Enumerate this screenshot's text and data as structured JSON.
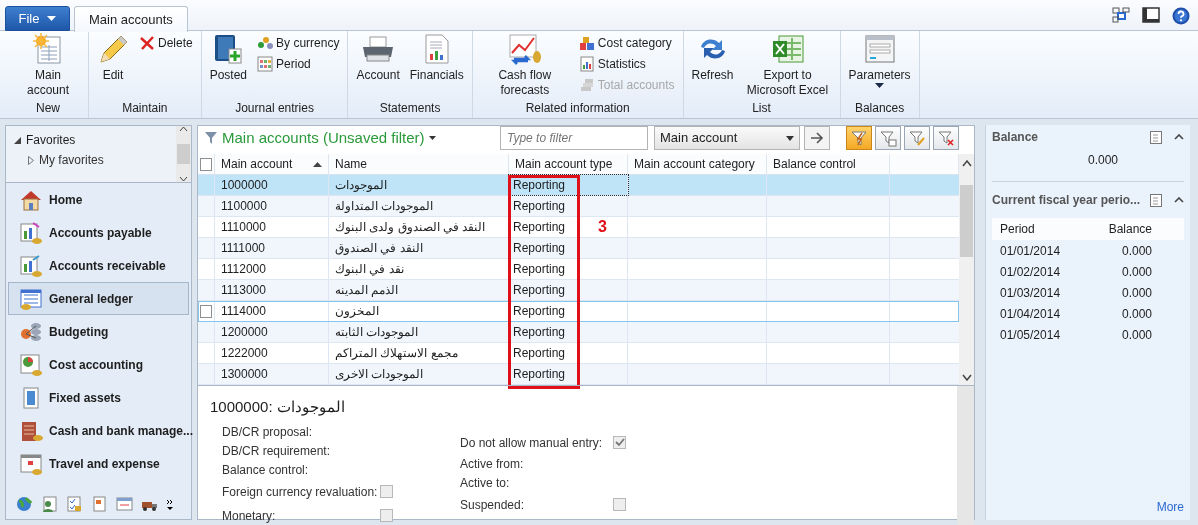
{
  "file_menu": {
    "label": "File"
  },
  "tabs": [
    {
      "label": "Main accounts",
      "selected": true
    }
  ],
  "ribbon": [
    {
      "label": "New",
      "buttons": [
        {
          "kind": "large",
          "label": "Main account",
          "disabled": false
        }
      ]
    },
    {
      "label": "Maintain",
      "buttons": [
        {
          "kind": "large",
          "label": "Edit",
          "disabled": false
        },
        {
          "kind": "small",
          "label": "Delete",
          "disabled": false
        }
      ]
    },
    {
      "label": "Journal entries",
      "buttons": [
        {
          "kind": "large",
          "label": "Posted",
          "disabled": false
        },
        {
          "kind": "small",
          "label": "By currency",
          "disabled": false
        },
        {
          "kind": "small",
          "label": "Period",
          "disabled": false
        }
      ]
    },
    {
      "label": "Statements",
      "buttons": [
        {
          "kind": "large",
          "label": "Account",
          "disabled": false
        },
        {
          "kind": "large",
          "label": "Financials",
          "disabled": false
        }
      ]
    },
    {
      "label": "Related information",
      "buttons": [
        {
          "kind": "large",
          "label": "Cash flow forecasts",
          "disabled": false
        },
        {
          "kind": "small",
          "label": "Cost category",
          "disabled": false
        },
        {
          "kind": "small",
          "label": "Statistics",
          "disabled": false
        },
        {
          "kind": "small",
          "label": "Total accounts",
          "disabled": true
        }
      ]
    },
    {
      "label": "List",
      "buttons": [
        {
          "kind": "large",
          "label": "Refresh",
          "disabled": false
        },
        {
          "kind": "large",
          "label": "Export to Microsoft Excel",
          "disabled": false
        }
      ]
    },
    {
      "label": "Balances",
      "buttons": [
        {
          "kind": "dropdown",
          "label": "Parameters",
          "disabled": false
        }
      ]
    }
  ],
  "nav": {
    "favorites": {
      "label": "Favorites",
      "expanded": true,
      "children": [
        {
          "label": "My favorites",
          "expanded": false
        }
      ]
    },
    "modules": [
      {
        "label": "Home",
        "selected": false
      },
      {
        "label": "Accounts payable",
        "selected": false
      },
      {
        "label": "Accounts receivable",
        "selected": false
      },
      {
        "label": "General ledger",
        "selected": true
      },
      {
        "label": "Budgeting",
        "selected": false
      },
      {
        "label": "Cost accounting",
        "selected": false
      },
      {
        "label": "Fixed assets",
        "selected": false
      },
      {
        "label": "Cash and bank manage...",
        "selected": false
      },
      {
        "label": "Travel and expense",
        "selected": false
      }
    ]
  },
  "grid": {
    "title": "Main accounts (Unsaved filter)",
    "filter_placeholder": "Type to filter",
    "filter_field": "Main account",
    "select_all": {
      "checked": false
    },
    "filter_buttons": [
      {
        "selected": true
      },
      {
        "selected": false
      },
      {
        "selected": false
      },
      {
        "selected": false
      }
    ],
    "columns": [
      {
        "label": "Main account",
        "sorted": true
      },
      {
        "label": "Name",
        "sorted": false
      },
      {
        "label": "Main account type",
        "sorted": false
      },
      {
        "label": "Main account category",
        "sorted": false
      },
      {
        "label": "Balance control",
        "sorted": false
      }
    ],
    "rows": [
      {
        "account": "1000000",
        "name": "الموجودات",
        "type": "Reporting",
        "selected": true,
        "hovered": false
      },
      {
        "account": "1100000",
        "name": "الموجودات المتداولة",
        "type": "Reporting",
        "selected": false,
        "hovered": false
      },
      {
        "account": "1110000",
        "name": "النقد في الصندوق ولدى البنوك",
        "type": "Reporting",
        "selected": false,
        "hovered": false
      },
      {
        "account": "1111000",
        "name": "النقد في الصندوق",
        "type": "Reporting",
        "selected": false,
        "hovered": false
      },
      {
        "account": "1112000",
        "name": "نقد في البنوك",
        "type": "Reporting",
        "selected": false,
        "hovered": false
      },
      {
        "account": "1113000",
        "name": "الذمم المدينه",
        "type": "Reporting",
        "selected": false,
        "hovered": false
      },
      {
        "account": "1114000",
        "name": "المخزون",
        "type": "Reporting",
        "selected": false,
        "hovered": true
      },
      {
        "account": "1200000",
        "name": "الموجودات الثابته",
        "type": "Reporting",
        "selected": false,
        "hovered": false
      },
      {
        "account": "1222000",
        "name": "مجمع الاستهلاك المتراكم",
        "type": "Reporting",
        "selected": false,
        "hovered": false
      },
      {
        "account": "1300000",
        "name": "الموجودات الاخرى",
        "type": "Reporting",
        "selected": false,
        "hovered": false
      }
    ],
    "annotation": {
      "label": "3"
    }
  },
  "details": {
    "title": "1000000: الموجودات",
    "left": [
      {
        "kind": "text",
        "label": "DB/CR proposal:"
      },
      {
        "kind": "text",
        "label": "DB/CR requirement:"
      },
      {
        "kind": "text",
        "label": "Balance control:"
      },
      {
        "kind": "checkbox",
        "label": "Foreign currency revaluation:",
        "checked": false
      },
      {
        "kind": "checkbox",
        "label": "Monetary:",
        "checked": false
      }
    ],
    "right": [
      {
        "kind": "checkbox",
        "label": "Do not allow manual entry:",
        "checked": true
      },
      {
        "kind": "text",
        "label": "Active from:"
      },
      {
        "kind": "text",
        "label": "Active to:"
      },
      {
        "kind": "checkbox",
        "label": "Suspended:",
        "checked": false
      }
    ]
  },
  "factbox": {
    "balance": {
      "title": "Balance",
      "value": "0.000"
    },
    "periods": {
      "title": "Current fiscal year perio...",
      "columns": [
        "Period",
        "Balance"
      ],
      "rows": [
        {
          "period": "01/01/2014",
          "balance": "0.000"
        },
        {
          "period": "01/02/2014",
          "balance": "0.000"
        },
        {
          "period": "01/03/2014",
          "balance": "0.000"
        },
        {
          "period": "01/04/2014",
          "balance": "0.000"
        },
        {
          "period": "01/05/2014",
          "balance": "0.000"
        }
      ]
    },
    "more": "More"
  }
}
